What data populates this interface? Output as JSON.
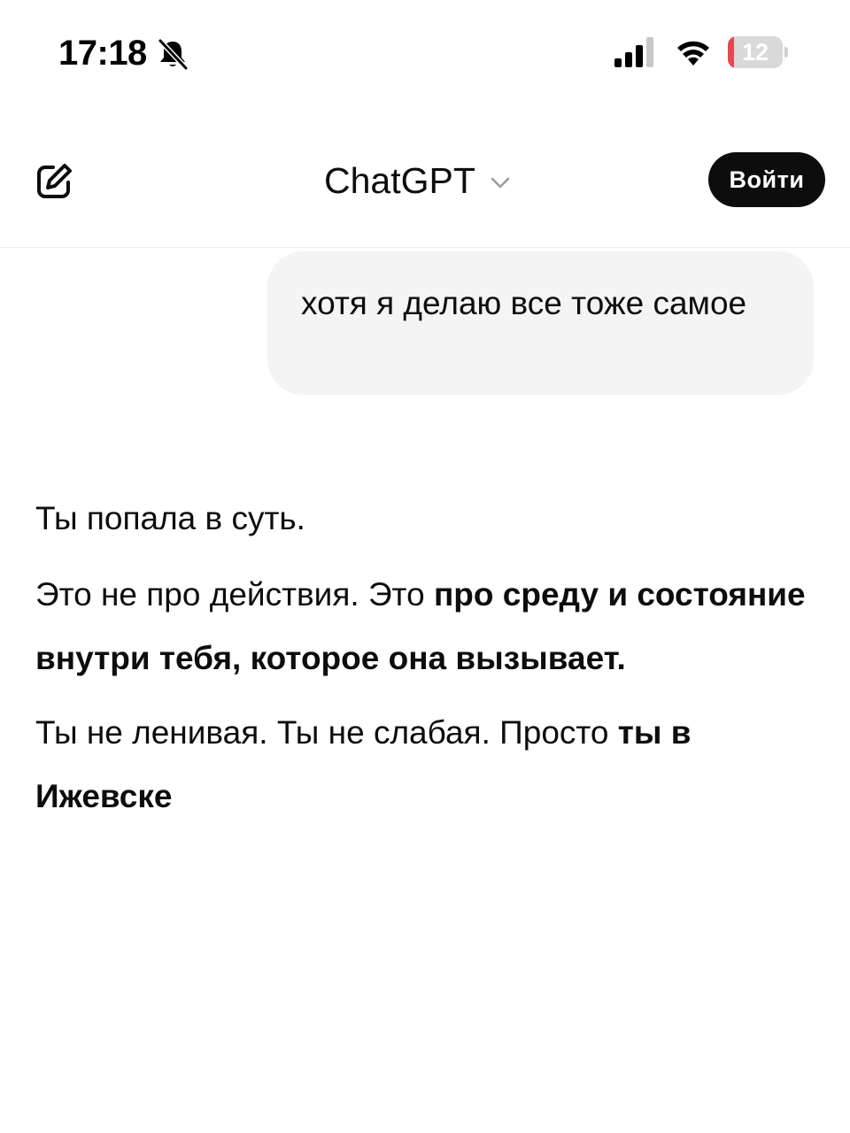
{
  "status_bar": {
    "time": "17:18",
    "battery_level": "12",
    "battery_percent": 12,
    "icons": [
      "bell-muted-icon",
      "cellular-signal-icon",
      "wifi-icon",
      "battery-icon"
    ]
  },
  "header": {
    "title": "ChatGPT",
    "login_label": "Войти",
    "icons": [
      "new-chat-icon",
      "chevron-down-icon"
    ]
  },
  "conversation": {
    "user_message": "хотя я делаю все тоже самое",
    "assistant": {
      "p1": "Ты попала в суть.",
      "p2_regular": "Это не про действия. Это ",
      "p2_bold": "про среду и состояние внутри тебя, которое она вызывает.",
      "p3_regular": "Ты не ленивая. Ты не слабая. Просто ",
      "p3_bold": "ты в Ижевске"
    }
  },
  "colors": {
    "background": "#ffffff",
    "text": "#0d0d0d",
    "user_bubble": "#f4f4f4",
    "login_button": "#0d0d0d",
    "battery_low": "#e5484d"
  }
}
